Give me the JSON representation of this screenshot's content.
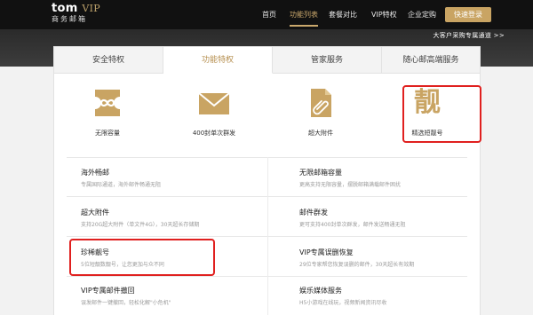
{
  "header": {
    "logo_main": "tom",
    "logo_vip": "VIP",
    "logo_sub": "商务邮箱",
    "nav": [
      "首页",
      "功能列表",
      "套餐对比",
      "VIP特权",
      "企业定购"
    ],
    "active_nav": "功能列表",
    "login_label": "快速登录",
    "hero_link": "大客户采购专属通道 >>"
  },
  "tabs": [
    {
      "label": "安全特权",
      "active": false
    },
    {
      "label": "功能特权",
      "active": true
    },
    {
      "label": "管家服务",
      "active": false
    },
    {
      "label": "随心邮高端服务",
      "active": false
    }
  ],
  "features": [
    {
      "icon": "infinity-icon",
      "label": "无限容量"
    },
    {
      "icon": "envelope-icon",
      "label": "400封单次群发"
    },
    {
      "icon": "paperclip-document-icon",
      "label": "超大附件"
    },
    {
      "icon": "jing-character-icon",
      "glyph": "靓",
      "label": "精选短靓号"
    }
  ],
  "items": [
    {
      "title": "海外畅邮",
      "desc": "专属国际通道，海外邮件畅通无阻"
    },
    {
      "title": "无限邮箱容量",
      "desc": "更高支持无限容量，摆脱邮箱满载邮件困扰"
    },
    {
      "title": "超大附件",
      "desc": "支持20G超大附件（单文件4G），30天超长存储期"
    },
    {
      "title": "邮件群发",
      "desc": "更可支持400封单次群发，邮件发送畅通无阻"
    },
    {
      "title": "珍稀靓号",
      "desc": "5位短靓数靓号，让您更加与众不同"
    },
    {
      "title": "VIP专属误删恢复",
      "desc": "29位专家帮您恢复误删的邮件，30天超长有效期"
    },
    {
      "title": "VIP专属邮件撤回",
      "desc": "误发邮件一键撤回，轻松化解\"小危机\""
    },
    {
      "title": "娱乐媒体服务",
      "desc": "H5小游戏在线玩，视频新闻资讯尽收"
    }
  ],
  "colors": {
    "gold": "#c9a463",
    "highlight": "#e0201f",
    "topbar": "#111111"
  }
}
